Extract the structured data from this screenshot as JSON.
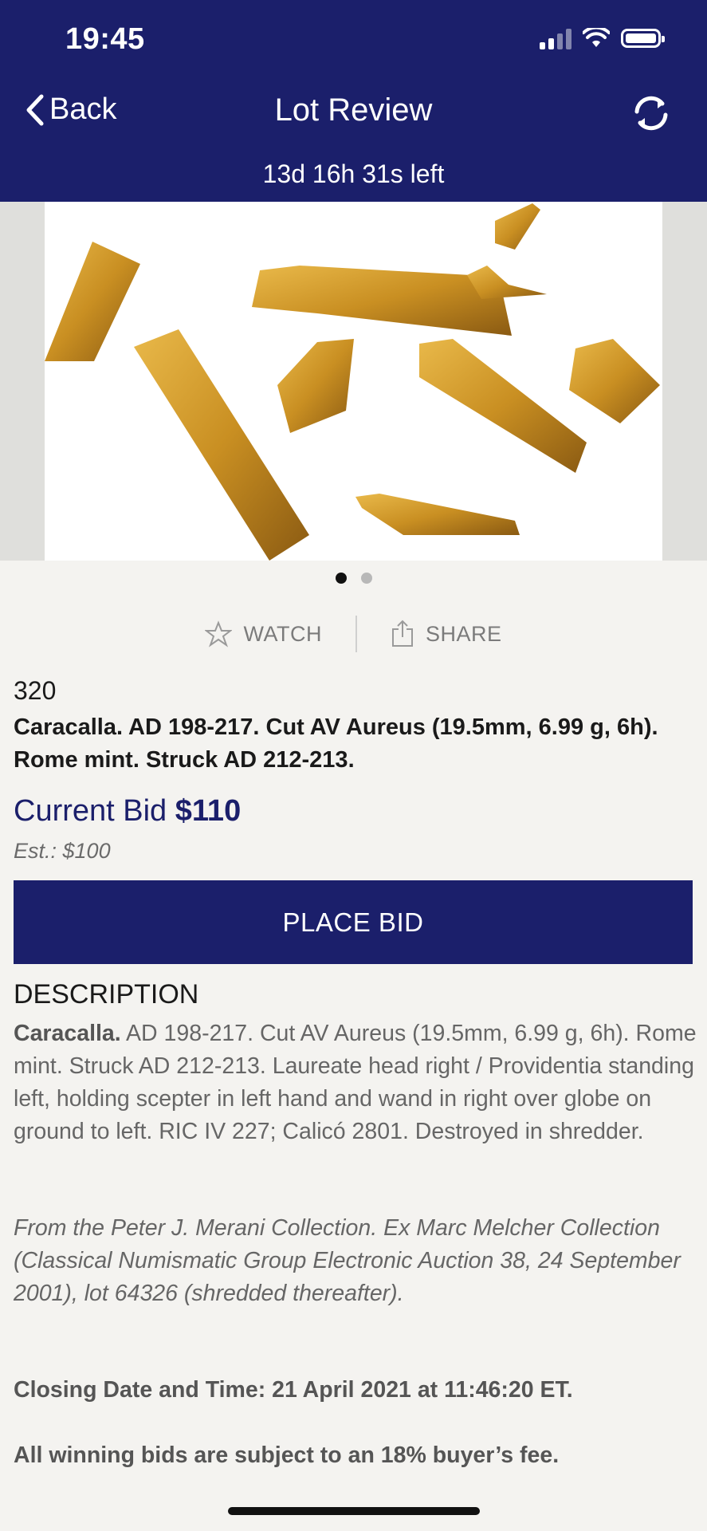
{
  "status_bar": {
    "time": "19:45"
  },
  "nav": {
    "back_label": "Back",
    "title": "Lot Review",
    "refresh_icon": "refresh-icon"
  },
  "countdown": "13d 16h 31s left",
  "gallery": {
    "image_alt": "Shredded gold coin fragments",
    "page_count": 2,
    "active_page": 1
  },
  "actions": {
    "watch_label": "WATCH",
    "share_label": "SHARE"
  },
  "lot": {
    "number": "320",
    "title": "Caracalla. AD 198-217. Cut AV Aureus (19.5mm, 6.99 g, 6h). Rome mint. Struck AD 212-213.",
    "current_bid_label": "Current Bid",
    "current_bid_value": "$110",
    "estimate": "Est.: $100"
  },
  "place_bid_label": "PLACE BID",
  "description": {
    "heading": "DESCRIPTION",
    "lead": "Caracalla.",
    "body": " AD 198-217. Cut AV Aureus (19.5mm, 6.99 g, 6h). Rome mint. Struck AD 212-213. Laureate head right / Providentia standing left, holding scepter in left hand and wand in right over globe on ground to left. RIC IV 227; Calicó 2801. Destroyed in shredder.",
    "provenance": "From the Peter J. Merani Collection. Ex Marc Melcher Collection (Classical Numismatic Group Electronic Auction 38, 24 September 2001), lot 64326 (shredded thereafter).",
    "closing": "Closing Date and Time: 21 April 2021 at 11:46:20 ET.",
    "fee_note": "All winning bids are subject to an 18% buyer’s fee."
  },
  "colors": {
    "brand": "#1b1f6b",
    "background": "#f4f3f0",
    "gold": "#c9962a"
  }
}
